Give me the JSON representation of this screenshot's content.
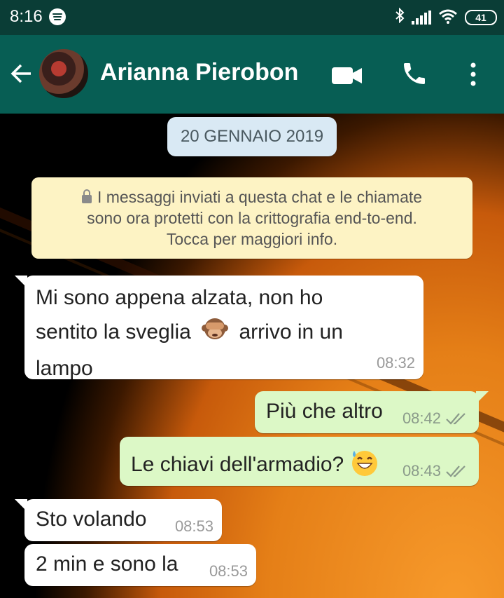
{
  "status_bar": {
    "time": "8:16",
    "battery": "41"
  },
  "header": {
    "back_label": "←",
    "contact_name": "Arianna Pierobon"
  },
  "chat": {
    "date_chip": "20 GENNAIO 2019",
    "encryption_notice": [
      "I messaggi inviati a questa chat e le chiamate",
      "sono ora protetti con la crittografia end-to-end.",
      "Tocca per maggiori info."
    ],
    "messages": [
      {
        "direction": "in",
        "lines": [
          "Mi sono appena alzata, non ho",
          "sentito la sveglia",
          "arrivo in un",
          "lampo"
        ],
        "emoji": "see-no-evil-monkey",
        "time": "08:32"
      },
      {
        "direction": "out",
        "text": "Più che altro",
        "time": "08:42",
        "status": "delivered"
      },
      {
        "direction": "out",
        "text": "Le chiavi dell'armadio?",
        "emoji": "grinning-sweat",
        "time": "08:43",
        "status": "delivered"
      },
      {
        "direction": "in",
        "text": "Sto volando",
        "time": "08:53"
      },
      {
        "direction": "in",
        "text": "2 min e sono la",
        "time": "08:53"
      }
    ]
  },
  "colors": {
    "status_bar": "#0a3d36",
    "app_bar": "#075e54",
    "incoming": "#ffffff",
    "outgoing": "#dcf8c6",
    "date_chip": "#d9e9f4",
    "notice": "#fdf3c4"
  },
  "icons": [
    "spotify-icon",
    "bluetooth-icon",
    "signal-icon",
    "wifi-icon",
    "battery-icon",
    "back-arrow-icon",
    "video-call-icon",
    "phone-call-icon",
    "more-options-icon",
    "lock-icon",
    "double-check-icon"
  ]
}
